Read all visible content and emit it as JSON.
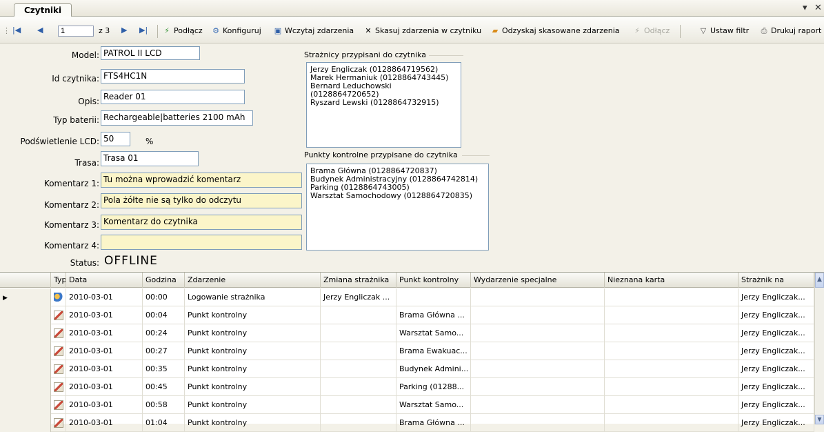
{
  "tab": {
    "title": "Czytniki"
  },
  "toolbar": {
    "page_value": "1",
    "page_total": "z 3",
    "connect": "Podłącz",
    "configure": "Konfiguruj",
    "load_events": "Wczytaj zdarzenia",
    "delete_events": "Skasuj zdarzenia w czytniku",
    "recover_events": "Odzyskaj skasowane zdarzenia",
    "disconnect": "Odłącz",
    "set_filter": "Ustaw filtr",
    "print_report": "Drukuj raport"
  },
  "form": {
    "model_label": "Model:",
    "model_value": "PATROL II LCD",
    "id_label": "Id czytnika:",
    "id_value": "FTS4HC1N",
    "desc_label": "Opis:",
    "desc_value": "Reader 01",
    "battery_label": "Typ baterii:",
    "battery_value": "Rechargeable|batteries  2100 mAh",
    "lcd_label": "Podświetlenie LCD:",
    "lcd_value": "50",
    "lcd_unit": "%",
    "route_label": "Trasa:",
    "route_value": "Trasa 01",
    "c1_label": "Komentarz 1:",
    "c1_value": "Tu można wprowadzić komentarz",
    "c2_label": "Komentarz 2:",
    "c2_value": "Pola żółte nie są tylko do odczytu",
    "c3_label": "Komentarz 3:",
    "c3_value": "Komentarz do czytnika",
    "c4_label": "Komentarz 4:",
    "c4_value": "",
    "status_label": "Status:",
    "status_value": "OFFLINE"
  },
  "guards": {
    "title": "Strażnicy przypisani do czytnika",
    "items": [
      "Jerzy Engliczak (0128864719562)",
      "Marek Hermaniuk (0128864743445)",
      "Bernard Leduchowski (0128864720652)",
      "Ryszard Lewski (0128864732915)"
    ]
  },
  "checkpoints": {
    "title": "Punkty kontrolne przypisane do czytnika",
    "items": [
      "Brama Główna (0128864720837)",
      "Budynek Administracyjny (0128864742814)",
      "Parking  (0128864743005)",
      "Warsztat Samochodowy (0128864720835)"
    ]
  },
  "grid": {
    "columns": [
      "Typ",
      "Data",
      "Godzina",
      "Zdarzenie",
      "Zmiana strażnika",
      "Punkt kontrolny",
      "Wydarzenie specjalne",
      "Nieznana karta",
      "Strażnik na"
    ],
    "rows": [
      {
        "type": "guard-login-icon",
        "date": "2010-03-01",
        "time": "00:00",
        "event": "Logowanie strażnika",
        "guard_change": "Jerzy Engliczak ...",
        "checkpoint": "",
        "special": "",
        "unknown": "",
        "guard": "Jerzy Engliczak..."
      },
      {
        "type": "checkpoint-icon",
        "date": "2010-03-01",
        "time": "00:04",
        "event": "Punkt kontrolny",
        "guard_change": "",
        "checkpoint": "Brama Główna ...",
        "special": "",
        "unknown": "",
        "guard": "Jerzy Engliczak..."
      },
      {
        "type": "checkpoint-icon",
        "date": "2010-03-01",
        "time": "00:24",
        "event": "Punkt kontrolny",
        "guard_change": "",
        "checkpoint": "Warsztat Samo...",
        "special": "",
        "unknown": "",
        "guard": "Jerzy Engliczak..."
      },
      {
        "type": "checkpoint-icon",
        "date": "2010-03-01",
        "time": "00:27",
        "event": "Punkt kontrolny",
        "guard_change": "",
        "checkpoint": "Brama Ewakuac...",
        "special": "",
        "unknown": "",
        "guard": "Jerzy Engliczak..."
      },
      {
        "type": "checkpoint-icon",
        "date": "2010-03-01",
        "time": "00:35",
        "event": "Punkt kontrolny",
        "guard_change": "",
        "checkpoint": "Budynek Admini...",
        "special": "",
        "unknown": "",
        "guard": "Jerzy Engliczak..."
      },
      {
        "type": "checkpoint-icon",
        "date": "2010-03-01",
        "time": "00:45",
        "event": "Punkt kontrolny",
        "guard_change": "",
        "checkpoint": "Parking  (01288...",
        "special": "",
        "unknown": "",
        "guard": "Jerzy Engliczak..."
      },
      {
        "type": "checkpoint-icon",
        "date": "2010-03-01",
        "time": "00:58",
        "event": "Punkt kontrolny",
        "guard_change": "",
        "checkpoint": "Warsztat Samo...",
        "special": "",
        "unknown": "",
        "guard": "Jerzy Engliczak..."
      },
      {
        "type": "checkpoint-icon",
        "date": "2010-03-01",
        "time": "01:04",
        "event": "Punkt kontrolny",
        "guard_change": "",
        "checkpoint": "Brama Główna ...",
        "special": "",
        "unknown": "",
        "guard": "Jerzy Engliczak..."
      }
    ]
  }
}
